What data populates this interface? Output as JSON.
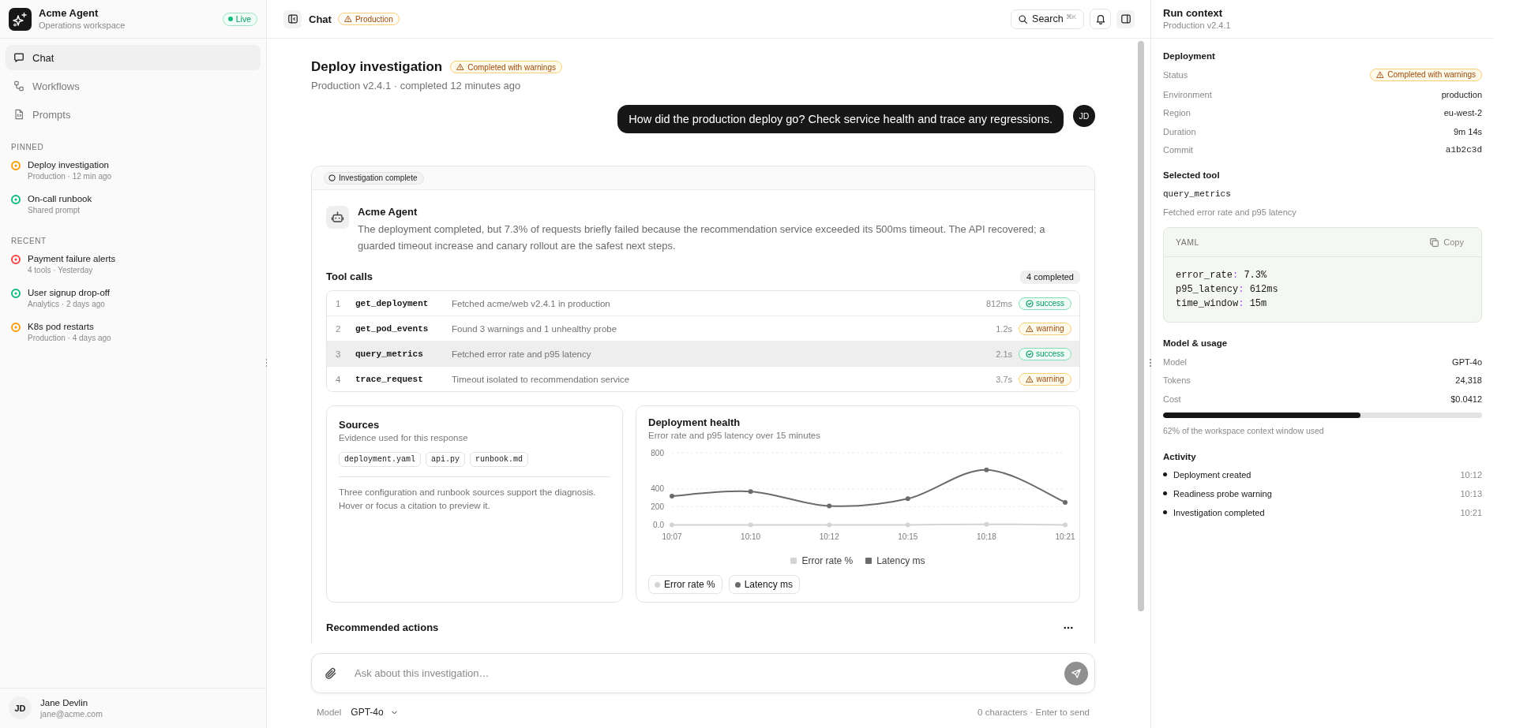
{
  "sidebar": {
    "brand": {
      "name": "Acme Agent",
      "subtitle": "Operations workspace",
      "status": "Live"
    },
    "nav": [
      {
        "label": "Chat",
        "selected": true
      },
      {
        "label": "Workflows",
        "selected": false
      },
      {
        "label": "Prompts",
        "selected": false
      }
    ],
    "sections": [
      {
        "title": "PINNED",
        "items": [
          {
            "title": "Deploy investigation",
            "meta": "Production · 12 min ago",
            "color": "#f59e0b"
          },
          {
            "title": "On-call runbook",
            "meta": "Shared prompt",
            "color": "#10b981"
          }
        ]
      },
      {
        "title": "RECENT",
        "items": [
          {
            "title": "Payment failure alerts",
            "meta": "4 tools · Yesterday",
            "color": "#ef4444"
          },
          {
            "title": "User signup drop-off",
            "meta": "Analytics · 2 days ago",
            "color": "#10b981"
          },
          {
            "title": "K8s pod restarts",
            "meta": "Production · 4 days ago",
            "color": "#f59e0b"
          }
        ]
      }
    ],
    "user": {
      "initials": "JD",
      "name": "Jane Devlin",
      "email": "jane@acme.com"
    }
  },
  "header": {
    "title": "Chat",
    "badge": "Production",
    "search": "Search",
    "shortcut": "⌘K"
  },
  "conversation": {
    "title": "Deploy investigation",
    "status": "Completed with warnings",
    "subtitle": "Production v2.4.1 · completed 12 minutes ago",
    "user_message": {
      "text": "How did the production deploy go? Check service health and trace any regressions.",
      "initials": "JD"
    },
    "agent_card": {
      "status": "Investigation complete",
      "agent_name": "Acme Agent",
      "answer": "The deployment completed, but 7.3% of requests briefly failed because the recommendation service exceeded its 500ms timeout. The API recovered; a guarded timeout increase and canary rollout are the safest next steps.",
      "tool_calls": {
        "title": "Tool calls",
        "count": "4 completed",
        "rows": [
          {
            "index": "1",
            "name": "get_deployment",
            "description": "Fetched acme/web v2.4.1 in production",
            "duration": "812ms",
            "status": "success",
            "kind": "success",
            "selected": false
          },
          {
            "index": "2",
            "name": "get_pod_events",
            "description": "Found 3 warnings and 1 unhealthy probe",
            "duration": "1.2s",
            "status": "warning",
            "kind": "warning",
            "selected": false
          },
          {
            "index": "3",
            "name": "query_metrics",
            "description": "Fetched error rate and p95 latency",
            "duration": "2.1s",
            "status": "success",
            "kind": "success",
            "selected": true
          },
          {
            "index": "4",
            "name": "trace_request",
            "description": "Timeout isolated to recommendation service",
            "duration": "3.7s",
            "status": "warning",
            "kind": "warning",
            "selected": false
          }
        ]
      },
      "sources": {
        "title": "Sources",
        "subtitle": "Evidence used for this response",
        "files": [
          "deployment.yaml",
          "api.py",
          "runbook.md"
        ],
        "note": "Three configuration and runbook sources support the diagnosis. Hover or focus a citation to preview it."
      },
      "health": {
        "title": "Deployment health",
        "subtitle": "Error rate and p95 latency over 15 minutes",
        "chart_data": {
          "type": "line",
          "categories": [
            "10:07",
            "10:10",
            "10:12",
            "10:15",
            "10:18",
            "10:21"
          ],
          "series": [
            {
              "name": "Error rate %",
              "color": "#d4d4d4",
              "marker": "circle",
              "values": [
                0,
                0,
                0,
                1,
                7,
                1
              ]
            },
            {
              "name": "Latency ms",
              "color": "#6b6b6b",
              "marker": "circle",
              "values": [
                320,
                370,
                210,
                290,
                610,
                250
              ]
            }
          ],
          "ylim": [
            0,
            800
          ],
          "yticks": [
            {
              "value": 0,
              "label": "0.0"
            },
            200,
            400,
            800
          ],
          "legend": "bottom"
        },
        "series_toggles": [
          {
            "label": "Error rate %",
            "color": "#d4d4d4"
          },
          {
            "label": "Latency ms",
            "color": "#6b6b6b"
          }
        ]
      },
      "actions_title": "Recommended actions"
    }
  },
  "composer": {
    "placeholder": "Ask about this investigation…",
    "model_label": "Model",
    "model": "GPT-4o",
    "hint": "0 characters · Enter to send"
  },
  "run_context": {
    "title": "Run context",
    "subtitle": "Production v2.4.1",
    "deployment": {
      "title": "Deployment",
      "rows": [
        {
          "label": "Status",
          "value": "Completed with warnings",
          "kind": "badge"
        },
        {
          "label": "Environment",
          "value": "production",
          "kind": "text"
        },
        {
          "label": "Region",
          "value": "eu-west-2",
          "kind": "text"
        },
        {
          "label": "Duration",
          "value": "9m 14s",
          "kind": "text"
        },
        {
          "label": "Commit",
          "value": "a1b2c3d",
          "kind": "mono"
        }
      ]
    },
    "selected_tool": {
      "title": "Selected tool",
      "name": "query_metrics",
      "description": "Fetched error rate and p95 latency",
      "code": {
        "language": "YAML",
        "copy": "Copy",
        "lines": [
          {
            "key": "error_rate",
            "separator": ":",
            "value": "7.3%"
          },
          {
            "key": "p95_latency",
            "separator": ":",
            "value": "612ms"
          },
          {
            "key": "time_window",
            "separator": ":",
            "value": "15m"
          }
        ]
      }
    },
    "usage": {
      "title": "Model & usage",
      "rows": [
        {
          "label": "Model",
          "value": "GPT-4o"
        },
        {
          "label": "Tokens",
          "value": "24,318"
        },
        {
          "label": "Cost",
          "value": "$0.0412"
        }
      ],
      "level": 0.62,
      "caption": "62% of the workspace context window used"
    },
    "activity": {
      "title": "Activity",
      "items": [
        {
          "label": "Deployment created",
          "time": "10:12"
        },
        {
          "label": "Readiness probe warning",
          "time": "10:13"
        },
        {
          "label": "Investigation completed",
          "time": "10:21"
        }
      ]
    }
  }
}
